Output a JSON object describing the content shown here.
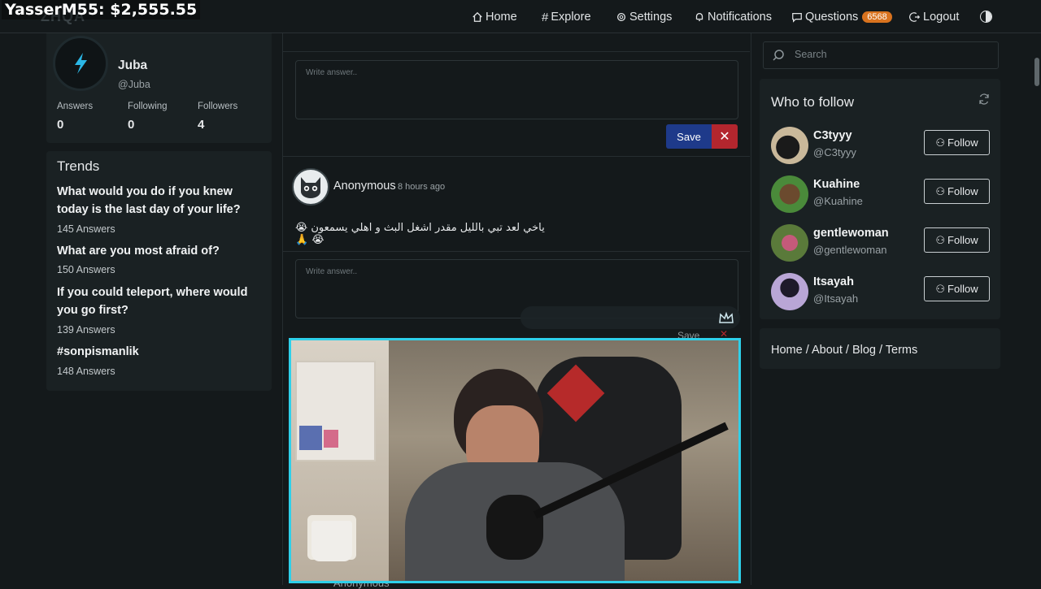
{
  "overlay": {
    "donation": "YasserM55: $2,555.55"
  },
  "nav": {
    "logo": "ZHQA",
    "items": [
      {
        "label": "Home",
        "icon": "home-icon"
      },
      {
        "label": "Explore",
        "icon": "hash-icon"
      },
      {
        "label": "Settings",
        "icon": "gear-icon"
      },
      {
        "label": "Notifications",
        "icon": "bell-icon"
      },
      {
        "label": "Questions",
        "icon": "chat-icon",
        "badge": "6568"
      },
      {
        "label": "Logout",
        "icon": "logout-icon"
      }
    ]
  },
  "profile": {
    "name": "Juba",
    "handle": "@Juba",
    "stats": [
      {
        "label": "Answers",
        "value": "0"
      },
      {
        "label": "Following",
        "value": "0"
      },
      {
        "label": "Followers",
        "value": "4"
      }
    ]
  },
  "trends": {
    "title": "Trends",
    "items": [
      {
        "q": "What would you do if you knew today is the last day of your life?",
        "a": "145 Answers"
      },
      {
        "q": "What are you most afraid of?",
        "a": "150 Answers"
      },
      {
        "q": "If you could teleport, where would you go first?",
        "a": "139 Answers"
      },
      {
        "q": "#sonpismanlik",
        "a": "148 Answers"
      }
    ]
  },
  "feed": {
    "answer_placeholder": "Write answer..",
    "save_label": "Save",
    "close_label": "✕",
    "question": {
      "author": "Anonymous",
      "time": "8 hours ago",
      "text": "ياخي لعد تبي بالليل مقدر اشغل البث و اهلي يسمعون 😭 😭 🙏"
    },
    "next_author": "Anonymous"
  },
  "sidebar": {
    "search_placeholder": "Search",
    "who_to_follow": "Who to follow",
    "follow_label": "Follow",
    "users": [
      {
        "name": "C3tyyy",
        "handle": "@C3tyyy",
        "color": "#3b3a35"
      },
      {
        "name": "Kuahine",
        "handle": "@Kuahine",
        "color": "#4a6b3a"
      },
      {
        "name": "gentlewoman",
        "handle": "@gentlewoman",
        "color": "#7b4a5a"
      },
      {
        "name": "Itsayah",
        "handle": "@Itsayah",
        "color": "#5a4a6e"
      }
    ],
    "footer": "Home / About / Blog / Terms"
  },
  "colors": {
    "accent_badge": "#d9731f",
    "save": "#1e3a8a",
    "cancel": "#b3262e",
    "video_border": "#2ed0ea"
  }
}
